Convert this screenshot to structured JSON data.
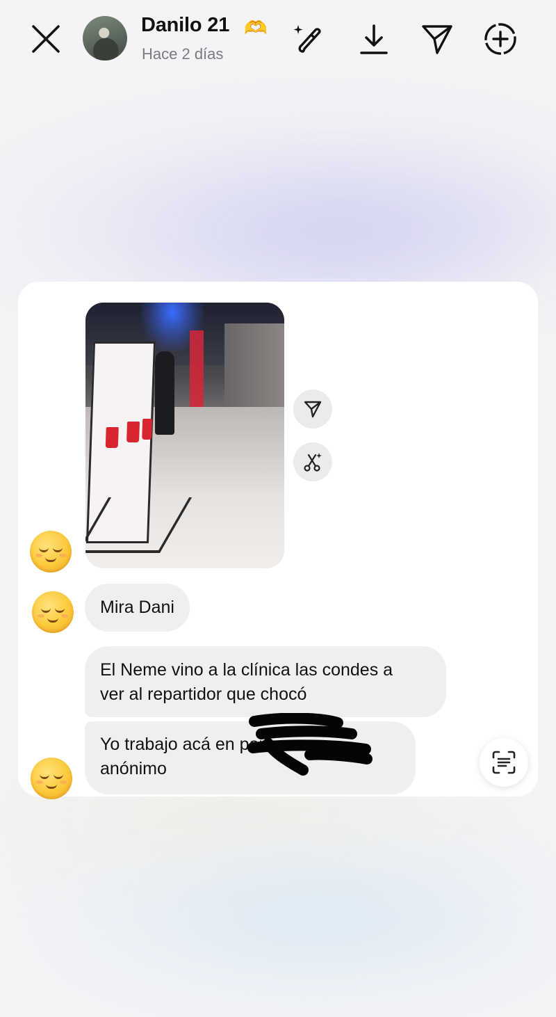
{
  "header": {
    "user_name": "Danilo 21",
    "badge_emoji": "🫶",
    "timestamp": "Hace 2 días",
    "icons": [
      "close-icon",
      "avatar",
      "edit-sparkle-icon",
      "download-icon",
      "send-icon",
      "add-story-icon"
    ]
  },
  "photo_actions": {
    "icons": [
      "send-icon",
      "remix-icon"
    ]
  },
  "messages": [
    {
      "type": "photo",
      "reaction_emoji": "😌"
    },
    {
      "type": "text",
      "text": "Mira Dani",
      "reaction_emoji": "😌"
    },
    {
      "type": "text",
      "text": "El Neme vino a la clínica las condes a\nver al repartidor que chocó"
    },
    {
      "type": "text",
      "text": "Yo trabajo acá en porfa\nanónimo",
      "reaction_emoji": "😌",
      "redacted": true
    }
  ],
  "colors": {
    "bubble": "#efeff2",
    "badge": "#f1b42f",
    "timestamp": "#7a7a80"
  }
}
